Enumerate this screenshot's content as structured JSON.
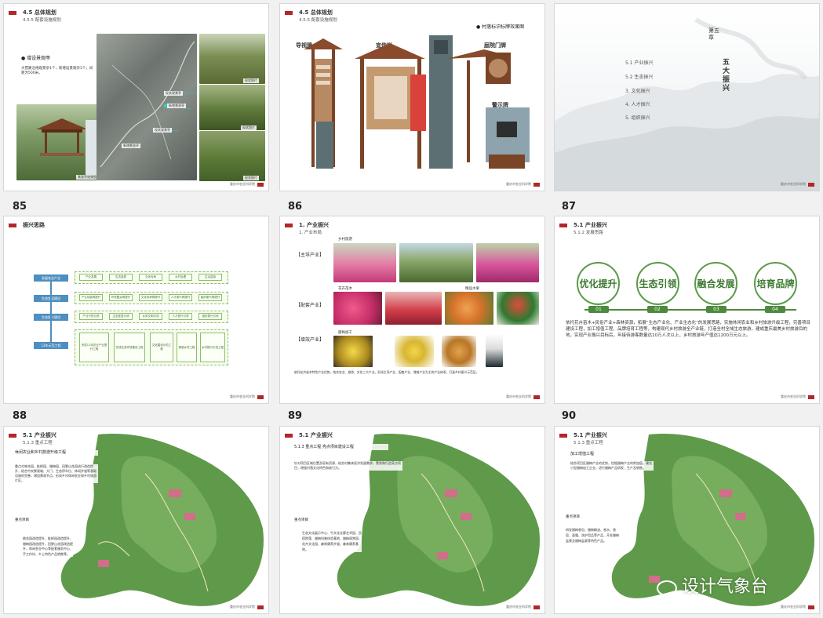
{
  "footer": {
    "text": "重庆市农业科学院"
  },
  "watermark": "设计气象台",
  "colors": {
    "accent": "#b3262a",
    "green": "#4d8a3e",
    "blue": "#4e8fc0"
  },
  "slides": {
    "s85": {
      "number": "85",
      "title": "4.5 总体规划",
      "subtitle": "4.5.5 配套设施规划",
      "bullet": "增设景观亭",
      "body": "大营路沿线观景亭1个，新增设景观亭1个，间距为500米。",
      "pavilion_caption": "景观亭效果图",
      "map_labels": [
        "现状观景亭",
        "新增景观亭",
        "现状观景亭",
        "新增景观亭"
      ],
      "photo_captions": [
        "现状照片",
        "现状照片",
        "现状照片"
      ]
    },
    "s86": {
      "number": "86",
      "title": "4.5 总体规划",
      "subtitle": "4.5.5 配套设施规划",
      "bullet": "村落标识标牌效果图",
      "labels": [
        "导视牌",
        "宣传栏",
        "庭院门牌",
        "警示牌"
      ]
    },
    "s87": {
      "number": "87",
      "chapter": "第五章",
      "chapter_title": "五大振兴",
      "toc": [
        "5.1 产业振兴",
        "5.2 生态振兴",
        "3. 文化振兴",
        "4. 人才振兴",
        "5. 组织振兴"
      ]
    },
    "s88": {
      "number": "88",
      "title": "振兴思路",
      "stages": [
        "发展农业产业",
        "生态宜居建设",
        "生态振兴建设",
        "12年示范工程"
      ],
      "row1": [
        "产业发展",
        "生态宜居",
        "文化传承",
        "乡村治理",
        "生活富裕"
      ],
      "row2": [
        "产业功能再提升",
        "环境整治再提升",
        "文化传承再提升",
        "人才振兴再提升",
        "组织振兴再提升"
      ],
      "row3": [
        "产业兴旺引领",
        "生态宜居引领",
        "乡风文明引领",
        "人才振兴引领",
        "组织振兴引领"
      ],
      "row4": [
        "完成12年农业产业提升工程",
        "完成生态环境建设工程",
        "文化建设示范工程",
        "美丽乡村工程",
        "乡村振兴示范工程"
      ]
    },
    "s89": {
      "number": "89",
      "title": "1. 产业振兴",
      "subtitle": "1. 产业布局",
      "categories": [
        "【主导产业】",
        "【配套产业】",
        "【增效产业】"
      ],
      "photo_labels": [
        "乡村旅游",
        "花卉苗木",
        "精品水果",
        "腊梅加工"
      ],
      "body": "依托花卉苗木特色产业优势，结合农业、旅游、文化三大产业，形成主导产业、配套产业、增效产业为主的产业体系，打造乡村振兴示范区。"
    },
    "s90": {
      "number": "90",
      "title": "5.1 产业振兴",
      "subtitle": "5.1.2 发展思路",
      "goals": [
        "优化提升",
        "生态引领",
        "融合发展",
        "培育品牌"
      ],
      "goal_numbers": [
        "01",
        "02",
        "03",
        "04"
      ],
      "body": "依托花卉苗木+民俗产业+森林资源，拓展“生态产业化、产业生态化”的发展思路，实施休闲农业和乡村旅游升级工程，完善项目建设工程，加工增值工程、品牌培育工程等，构建现代乡村旅游全产业链，打造全村全域生态旅游，建成重庆最美乡村旅游目的地，实现产业振兴目标后，年接待游客数量达10万人次以上，乡村旅游年产值达1200万元以上。"
    },
    "s91": {
      "title": "5.1 产业振兴",
      "subtitle": "5.1.3 重点工程",
      "heading": "休闲农业和乡村旅游升级工程",
      "body": "重点对林花园、枇杷园、腊梅园、田野山花园进行改造提升，结合中央景观轴、大门、生态停车位、休闲步道等基础设施的完善，增加景观节点，形成乡村休闲农业和乡村旅游片区。",
      "key_label": "重点项目",
      "key_text": "桃花园改造提升、枇杷园改造提升、腊梅园改造提升、田野山花园改造提升、休闲农业中心等配套服务中心、手工作坊、乡土特色产品销售等。"
    },
    "s92": {
      "title": "5.1 产业振兴",
      "subtitle": "",
      "heading": "5.1.3 重点工程 亮点项目建设工程",
      "body": "针对项目区域位置及现有资源，结合村集体经济发展需求，策划和打造亮点项目，增强村落文化特色和吸引力。",
      "key_label": "重点项目",
      "key_text": "生态文化展示中心、牛文化长廊艺术园、民宿院落、腊梅科普体验基地、腊梅观赏园、花卉文化园、森林康养步道、森林康养基地。"
    },
    "s93": {
      "title": "5.1 产业振兴",
      "subtitle": "5.1.3 重点工程",
      "heading": "加工增值工程",
      "body": "结合项目区腊梅产业的优势，挖掘腊梅产业的附加值，建设小型腊梅加工企业，进行腊梅产品研发、生产及销售。",
      "key_label": "重点项目",
      "key_text": "研发腊梅香包、腊梅精油、香水、香皂、面霜、洗护用品等产品，开发腊梅盆景及腊梅盆栽等特色产品。"
    }
  }
}
